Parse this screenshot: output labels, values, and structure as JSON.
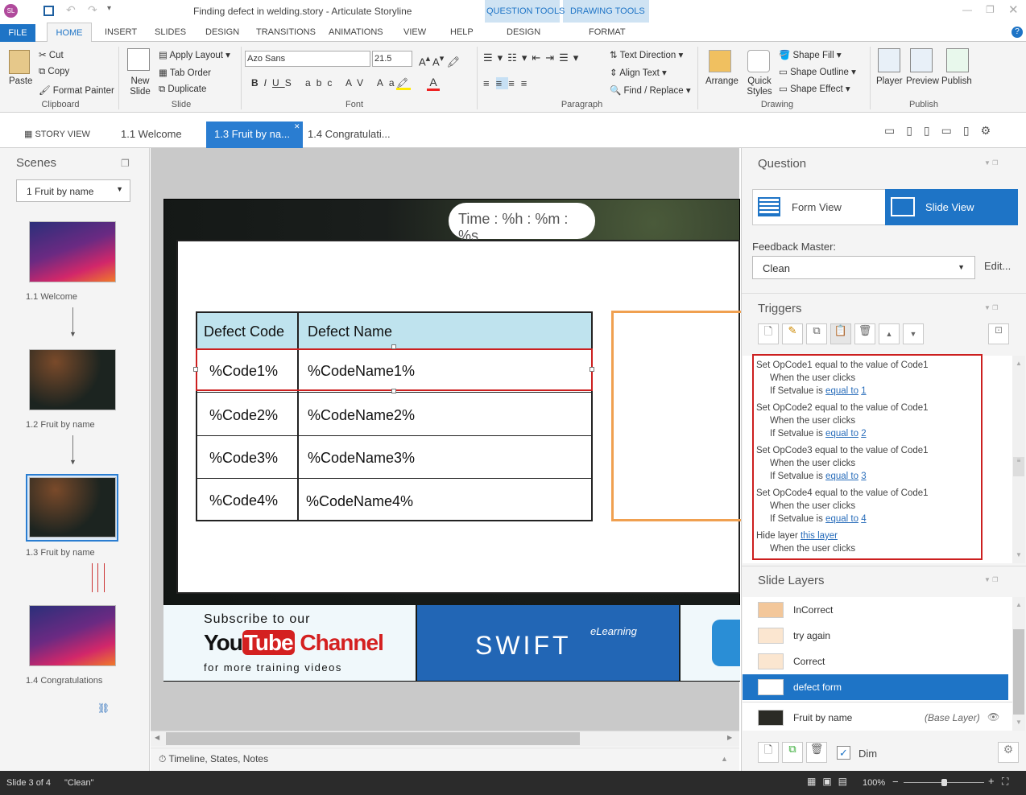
{
  "app": {
    "title": "Finding defect in welding.story - Articulate Storyline",
    "logo": "SL"
  },
  "contextual": {
    "qtools": "QUESTION TOOLS",
    "dtools": "DRAWING TOOLS",
    "design": "DESIGN",
    "format": "FORMAT"
  },
  "tabs": [
    "FILE",
    "HOME",
    "INSERT",
    "SLIDES",
    "DESIGN",
    "TRANSITIONS",
    "ANIMATIONS",
    "VIEW",
    "HELP"
  ],
  "ribbon": {
    "clipboard": {
      "paste": "Paste",
      "cut": "Cut",
      "copy": "Copy",
      "format_painter": "Format Painter",
      "label": "Clipboard"
    },
    "slide": {
      "new_slide": "New Slide",
      "apply_layout": "Apply Layout",
      "tab_order": "Tab Order",
      "duplicate": "Duplicate",
      "label": "Slide"
    },
    "font": {
      "name": "Azo Sans",
      "size": "21.5",
      "label": "Font"
    },
    "paragraph": {
      "text_direction": "Text Direction",
      "align_text": "Align Text",
      "find_replace": "Find / Replace",
      "label": "Paragraph"
    },
    "drawing": {
      "arrange": "Arrange",
      "quick_styles": "Quick Styles",
      "shape_fill": "Shape Fill",
      "shape_outline": "Shape Outline",
      "shape_effect": "Shape Effect",
      "label": "Drawing"
    },
    "publish": {
      "player": "Player",
      "preview": "Preview",
      "publish": "Publish",
      "label": "Publish"
    }
  },
  "viewtabs": {
    "story": "STORY VIEW",
    "t1": "1.1 Welcome",
    "t2": "1.3 Fruit by na...",
    "t3": "1.4 Congratulati..."
  },
  "scenes": {
    "title": "Scenes",
    "selector": "1 Fruit by name",
    "slides": [
      "1.1 Welcome",
      "1.2 Fruit by name",
      "1.3 Fruit by name",
      "1.4 Congratulations"
    ]
  },
  "slide": {
    "timer": "Time : %h : %m : %s",
    "table": {
      "headers": [
        "Defect Code",
        "Defect Name"
      ],
      "rows": [
        [
          "%Code1%",
          "%CodeName1%"
        ],
        [
          "%Code2%",
          "%CodeName2%"
        ],
        [
          "%Code3%",
          "%CodeName3%"
        ],
        [
          "%Code4%",
          "%CodeName4%"
        ]
      ]
    },
    "banner": {
      "subscribe": "Subscribe to our",
      "you": "You",
      "tube": "Tube",
      "channel": "Channel",
      "more": "for more training videos",
      "swift": "SWIFT",
      "elearning": "eLearning"
    }
  },
  "bottom": {
    "timeline": "Timeline, States, Notes"
  },
  "question": {
    "title": "Question",
    "form_view": "Form View",
    "slide_view": "Slide View",
    "feedback_master": "Feedback Master:",
    "master_value": "Clean",
    "edit": "Edit..."
  },
  "triggers": {
    "title": "Triggers",
    "items": [
      {
        "action": "Set OpCode1 equal to the value of Code1",
        "when": "When the user clicks",
        "if": "If Setvalue is",
        "op": "equal to",
        "val": "1"
      },
      {
        "action": "Set OpCode2 equal to the value of Code1",
        "when": "When the user clicks",
        "if": "If Setvalue is",
        "op": "equal to",
        "val": "2"
      },
      {
        "action": "Set OpCode3 equal to the value of Code1",
        "when": "When the user clicks",
        "if": "If Setvalue is",
        "op": "equal to",
        "val": "3"
      },
      {
        "action": "Set OpCode4 equal to the value of Code1",
        "when": "When the user clicks",
        "if": "If Setvalue is",
        "op": "equal to",
        "val": "4"
      }
    ],
    "hide": "Hide layer",
    "hide_link": "this layer",
    "hide_when": "When the user clicks"
  },
  "layers": {
    "title": "Slide Layers",
    "items": [
      "InCorrect",
      "try again",
      "Correct",
      "defect form",
      "Fruit by name"
    ],
    "base": "(Base Layer)",
    "dim": "Dim"
  },
  "status": {
    "slide": "Slide 3 of 4",
    "master": "\"Clean\"",
    "zoom": "100%"
  },
  "colors": {
    "accent": "#1e74c6",
    "selected": "#2a7dd1",
    "red": "#cc1f1f",
    "orange": "#f0a050",
    "table_header": "#bfe3ee"
  }
}
